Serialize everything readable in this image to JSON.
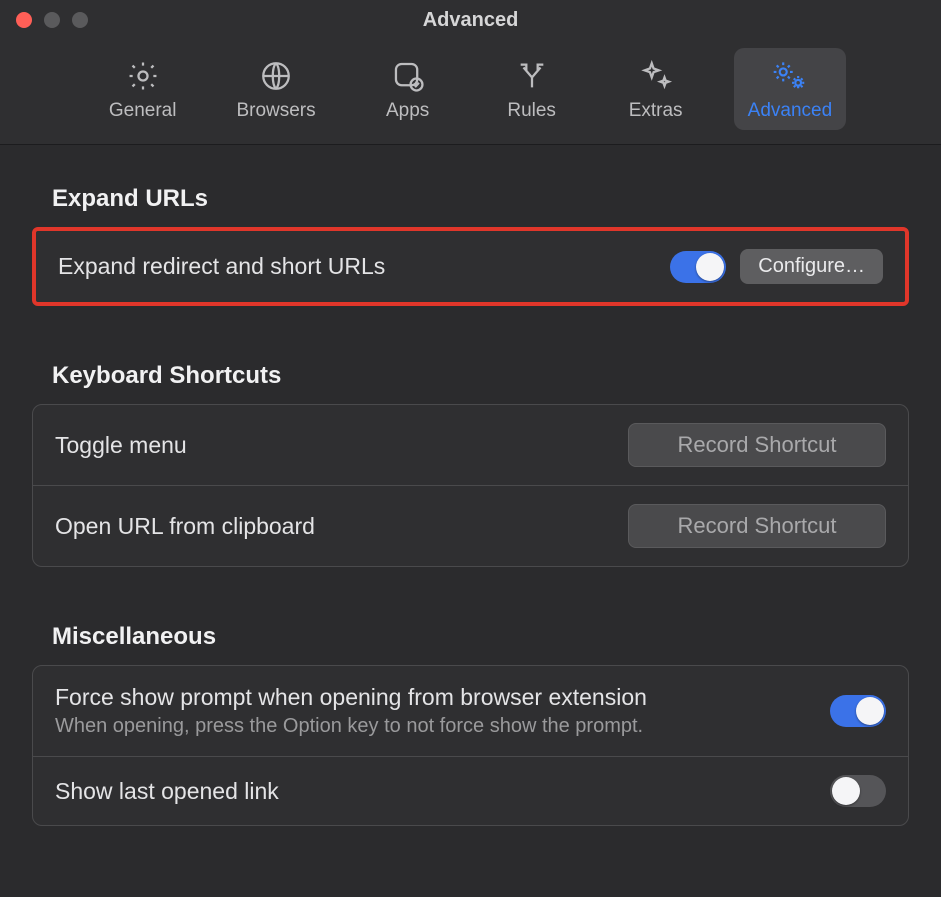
{
  "window": {
    "title": "Advanced"
  },
  "tabs": {
    "general": "General",
    "browsers": "Browsers",
    "apps": "Apps",
    "rules": "Rules",
    "extras": "Extras",
    "advanced": "Advanced",
    "active": "advanced"
  },
  "sections": {
    "expand_urls": {
      "title": "Expand URLs",
      "row_label": "Expand redirect and short URLs",
      "toggle_on": true,
      "configure_label": "Configure…"
    },
    "shortcuts": {
      "title": "Keyboard Shortcuts",
      "toggle_menu_label": "Toggle menu",
      "open_clipboard_label": "Open URL from clipboard",
      "record_label": "Record Shortcut"
    },
    "misc": {
      "title": "Miscellaneous",
      "force_prompt_label": "Force show prompt when opening from browser extension",
      "force_prompt_sub": "When opening, press the Option key to not force show the prompt.",
      "force_prompt_on": true,
      "show_last_link_label": "Show last opened link",
      "show_last_link_on": false
    }
  }
}
